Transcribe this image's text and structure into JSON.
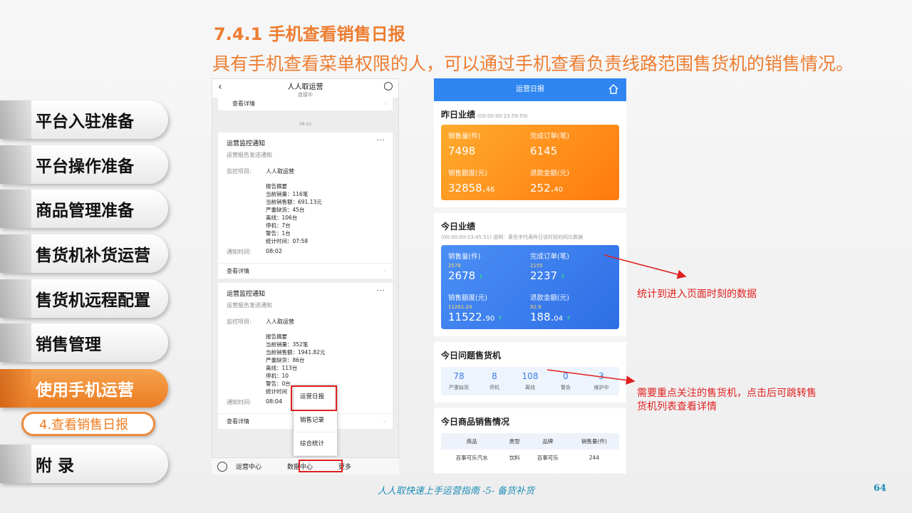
{
  "header": {
    "title": "7.4.1 手机查看销售日报",
    "subtitle": "具有手机查看菜单权限的人，可以通过手机查看负责线路范围售货机的销售情况。"
  },
  "sidebar": {
    "items": [
      {
        "label": "平台入驻准备"
      },
      {
        "label": "平台操作准备"
      },
      {
        "label": "商品管理准备"
      },
      {
        "label": "售货机补货运营"
      },
      {
        "label": "售货机远程配置"
      },
      {
        "label": "销售管理"
      },
      {
        "label": "使用手机运营"
      },
      {
        "label": "附 录"
      }
    ],
    "sub_item": "4.查看销售日报",
    "accent": "#ED7D31"
  },
  "phone1": {
    "title": "人人取运营",
    "status": "连接中",
    "view_details": "查看详情",
    "time": "08:02",
    "cards": [
      {
        "title": "运营监控通知",
        "sub": "运营报告发送通知",
        "project_label": "监控项目:",
        "project": "人人取运营",
        "summary": [
          "报告摘要",
          "当前销量：116笔",
          "当前销售额：691.13元",
          "严重缺货：45台",
          "离线：106台",
          "停机：7台",
          "警告：1台",
          "统计时间：07:58"
        ],
        "notify_label": "通知时间:",
        "notify_time": "08:02",
        "more": "查看详情"
      },
      {
        "title": "运营监控通知",
        "sub": "运营报告发送通知",
        "project_label": "监控项目:",
        "project": "人人取运营",
        "summary": [
          "报告摘要",
          "当前销量：352笔",
          "当前销售额：1941.82元",
          "严重缺货：86台",
          "离线：113台",
          "停机：10",
          "警告：0台",
          "统计时间"
        ],
        "notify_label": "通知时间:",
        "notify_time": "08:04",
        "more": "查看详情"
      }
    ],
    "popup": [
      "运营日报",
      "销售记录",
      "综合统计"
    ],
    "tabbar": [
      "运营中心",
      "数据中心",
      "更多"
    ]
  },
  "phone2": {
    "title": "运营日报",
    "yesterday": {
      "heading": "昨日业绩",
      "range": "(00:00:00-23:59:59)",
      "metrics": [
        {
          "icon": "flame-icon",
          "label": "销售量(件)",
          "value": "7498",
          "dec": ""
        },
        {
          "icon": "order-icon",
          "label": "完成订单(笔)",
          "value": "6145",
          "dec": ""
        },
        {
          "icon": "money-icon",
          "label": "销售额度(元)",
          "value": "32858.",
          "dec": "46"
        },
        {
          "icon": "refund-icon",
          "label": "退款金额(元)",
          "value": "252.",
          "dec": "40"
        }
      ]
    },
    "today": {
      "heading": "今日业绩",
      "range": "(00:00:00-13:45:51)",
      "note": "说明：黄色字代表昨日该时段的同比数据",
      "metrics": [
        {
          "icon": "flame-icon",
          "label": "销售量(件)",
          "prev": "2578",
          "value": "2678",
          "dec": ""
        },
        {
          "icon": "order-icon",
          "label": "完成订单(笔)",
          "prev": "2155",
          "value": "2237",
          "dec": ""
        },
        {
          "icon": "money-icon",
          "label": "销售额度(元)",
          "prev": "11261.24",
          "value": "11522.",
          "dec": "90"
        },
        {
          "icon": "refund-icon",
          "label": "退款金额(元)",
          "prev": "92.9",
          "value": "188.",
          "dec": "04"
        }
      ]
    },
    "problem": {
      "heading": "今日问题售货机",
      "stats": [
        {
          "n": "78",
          "l": "严重缺货"
        },
        {
          "n": "8",
          "l": "停机"
        },
        {
          "n": "108",
          "l": "离线"
        },
        {
          "n": "0",
          "l": "警告"
        },
        {
          "n": "3",
          "l": "维护中"
        }
      ]
    },
    "sales": {
      "heading": "今日商品销售情况",
      "columns": [
        "商品",
        "类型",
        "品牌",
        "销售量(件)"
      ],
      "rows": [
        [
          "百事可乐汽水",
          "饮料",
          "百事可乐",
          "244"
        ]
      ]
    }
  },
  "annotations": {
    "note1": "统计到进入页面时刻的数据",
    "note2": "需要重点关注的售货机，点击后可跳转售货机列表查看详情"
  },
  "footer": {
    "text": "人人取快速上手运营指南 -5- 备货补货",
    "page": "64"
  }
}
